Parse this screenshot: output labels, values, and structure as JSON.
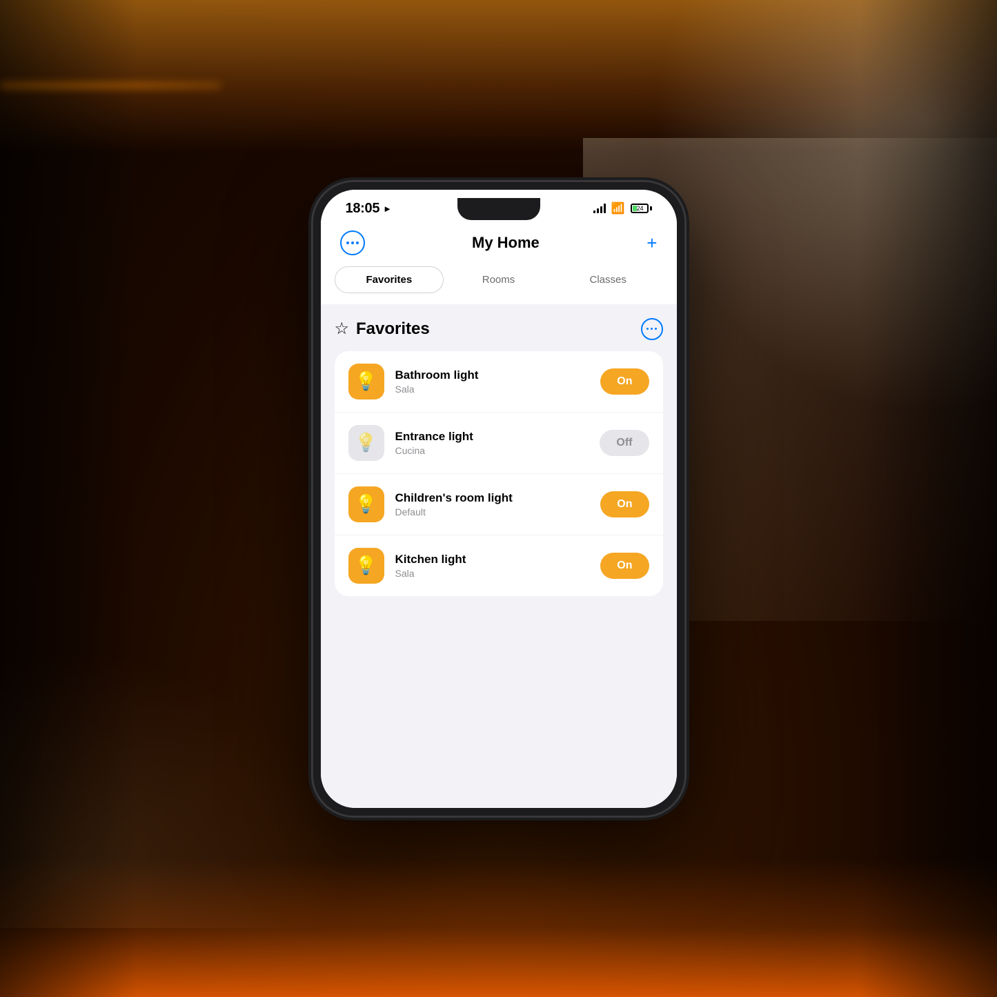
{
  "background": {
    "description": "Smart home living room with warm orange LED lighting"
  },
  "phone": {
    "status_bar": {
      "time": "18:05",
      "location_icon": "▶",
      "battery_level": 24,
      "battery_label": "24"
    },
    "header": {
      "menu_label": "···",
      "title": "My Home",
      "add_label": "+"
    },
    "tabs": [
      {
        "label": "Favorites",
        "active": true
      },
      {
        "label": "Rooms",
        "active": false
      },
      {
        "label": "Classes",
        "active": false
      }
    ],
    "favorites_section": {
      "title": "Favorites",
      "star": "☆",
      "more_label": "···",
      "devices": [
        {
          "name": "Bathroom light",
          "room": "Sala",
          "state": "on",
          "toggle_label": "On"
        },
        {
          "name": "Entrance light",
          "room": "Cucina",
          "state": "off",
          "toggle_label": "Off"
        },
        {
          "name": "Children's room light",
          "room": "Default",
          "state": "on",
          "toggle_label": "On"
        },
        {
          "name": "Kitchen light",
          "room": "Sala",
          "state": "on",
          "toggle_label": "On"
        }
      ]
    }
  }
}
